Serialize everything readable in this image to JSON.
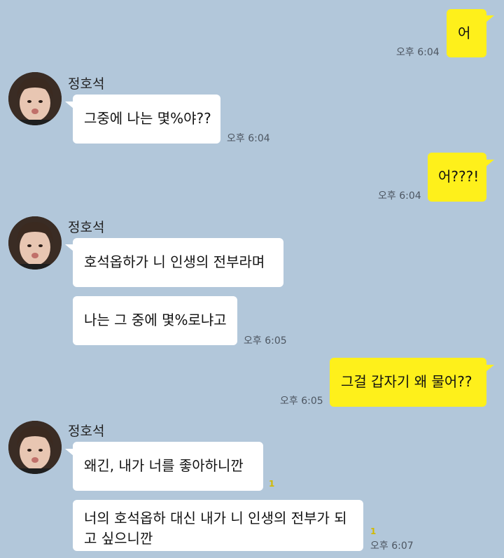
{
  "colors": {
    "background": "#b2c7da",
    "my_bubble": "#fef01b",
    "other_bubble": "#ffffff",
    "timestamp": "#4d5661",
    "unread_badge": "#d2b900"
  },
  "contact": {
    "name": "정호석",
    "avatar_icon": "profile-photo"
  },
  "messages": [
    {
      "sender": "me",
      "text": "어",
      "time": "오후 6:04"
    },
    {
      "sender": "other",
      "text": "그중에 나는 몇%야??",
      "time": "오후 6:04"
    },
    {
      "sender": "me",
      "text": "어???!",
      "time": "오후 6:04"
    },
    {
      "sender": "other",
      "text": "호석옵하가 니 인생의 전부라며"
    },
    {
      "sender": "other",
      "text": "나는 그 중에 몇%로냐고",
      "time": "오후 6:05"
    },
    {
      "sender": "me",
      "text": "그걸 갑자기 왜 물어??",
      "time": "오후 6:05"
    },
    {
      "sender": "other",
      "text": "왜긴, 내가 너를 좋아하니깐",
      "unread": "1"
    },
    {
      "sender": "other",
      "text": "너의 호석옵하 대신 내가 니 인생의 전부가 되고 싶으니깐",
      "time": "오후 6:07",
      "unread": "1"
    }
  ]
}
